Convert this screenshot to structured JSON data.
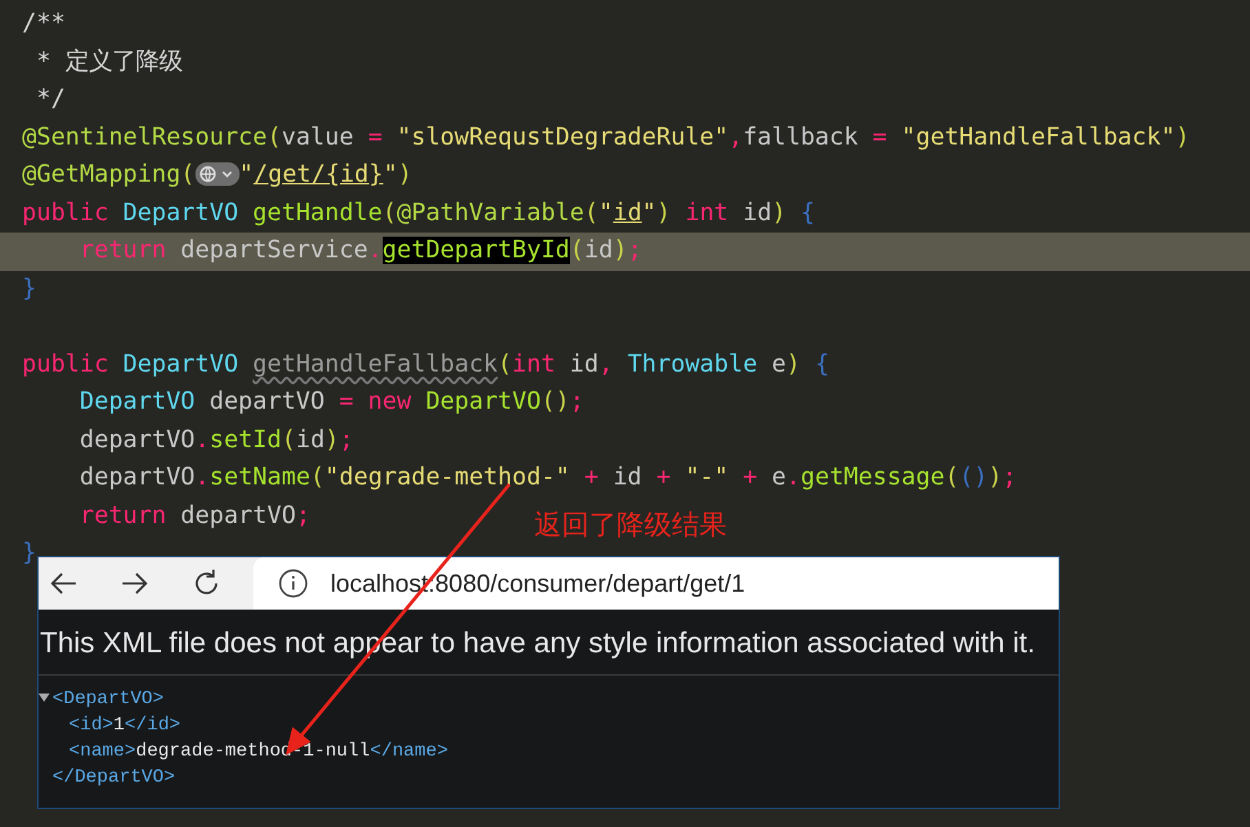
{
  "editor": {
    "methods": [
      {
        "lines": [
          {
            "highlighted": false,
            "tokens": [
              {
                "text": "/**",
                "kind": "comment"
              }
            ]
          },
          {
            "highlighted": false,
            "tokens": [
              {
                "text": " * 定义了降级",
                "kind": "comment"
              }
            ]
          },
          {
            "highlighted": false,
            "tokens": [
              {
                "text": " */",
                "kind": "comment"
              }
            ]
          },
          {
            "highlighted": false,
            "tokens": [
              {
                "text": "@SentinelResource",
                "kind": "annotation"
              },
              {
                "text": "(",
                "kind": "punct"
              },
              {
                "text": "value ",
                "kind": "text"
              },
              {
                "text": "= ",
                "kind": "operator"
              },
              {
                "text": "\"slowRequstDegradeRule\"",
                "kind": "string"
              },
              {
                "text": ",",
                "kind": "operator"
              },
              {
                "text": "fallback ",
                "kind": "text"
              },
              {
                "text": "= ",
                "kind": "operator"
              },
              {
                "text": "\"getHandleFallback\"",
                "kind": "string"
              },
              {
                "text": ")",
                "kind": "punct"
              }
            ]
          },
          {
            "highlighted": false,
            "tokens": [
              {
                "text": "@GetMapping",
                "kind": "annotation"
              },
              {
                "text": "(",
                "kind": "punct"
              },
              {
                "kind": "icon"
              },
              {
                "text": "\"",
                "kind": "string"
              },
              {
                "text": "/get/{id}",
                "kind": "link"
              },
              {
                "text": "\"",
                "kind": "string"
              },
              {
                "text": ")",
                "kind": "punct"
              }
            ]
          },
          {
            "highlighted": false,
            "tokens": [
              {
                "text": "public ",
                "kind": "keyword"
              },
              {
                "text": "DepartVO ",
                "kind": "type"
              },
              {
                "text": "getHandle",
                "kind": "method"
              },
              {
                "text": "(",
                "kind": "punct"
              },
              {
                "text": "@PathVariable",
                "kind": "annotation"
              },
              {
                "text": "(",
                "kind": "punct"
              },
              {
                "text": "\"",
                "kind": "string"
              },
              {
                "text": "id",
                "kind": "link"
              },
              {
                "text": "\"",
                "kind": "string"
              },
              {
                "text": ") ",
                "kind": "punct"
              },
              {
                "text": "int",
                "kind": "keyword"
              },
              {
                "text": " id",
                "kind": "text"
              },
              {
                "text": ") ",
                "kind": "punct"
              },
              {
                "text": "{",
                "kind": "brace"
              }
            ]
          },
          {
            "highlighted": true,
            "tokens": [
              {
                "text": "    return",
                "kind": "keyword"
              },
              {
                "text": " departService",
                "kind": "text"
              },
              {
                "text": ".",
                "kind": "operator"
              },
              {
                "text": "getDepartById",
                "kind": "match"
              },
              {
                "text": "(",
                "kind": "punct"
              },
              {
                "text": "id",
                "kind": "text"
              },
              {
                "text": ")",
                "kind": "punct"
              },
              {
                "text": ";",
                "kind": "operator"
              }
            ]
          },
          {
            "highlighted": false,
            "tokens": [
              {
                "text": "}",
                "kind": "brace"
              }
            ]
          }
        ]
      },
      {
        "lines": [
          {
            "highlighted": false,
            "tokens": [
              {
                "text": "public ",
                "kind": "keyword"
              },
              {
                "text": "DepartVO ",
                "kind": "type"
              },
              {
                "text": "getHandleFallback",
                "kind": "unused"
              },
              {
                "text": "(",
                "kind": "punct"
              },
              {
                "text": "int",
                "kind": "keyword"
              },
              {
                "text": " id",
                "kind": "text"
              },
              {
                "text": ", ",
                "kind": "operator"
              },
              {
                "text": "Throwable",
                "kind": "type"
              },
              {
                "text": " e",
                "kind": "text"
              },
              {
                "text": ") ",
                "kind": "punct"
              },
              {
                "text": "{",
                "kind": "brace"
              }
            ]
          },
          {
            "highlighted": false,
            "tokens": [
              {
                "text": "    DepartVO",
                "kind": "type"
              },
              {
                "text": " departVO ",
                "kind": "text"
              },
              {
                "text": "= ",
                "kind": "operator"
              },
              {
                "text": "new ",
                "kind": "keyword"
              },
              {
                "text": "DepartVO",
                "kind": "method"
              },
              {
                "text": "()",
                "kind": "punct"
              },
              {
                "text": ";",
                "kind": "operator"
              }
            ]
          },
          {
            "highlighted": false,
            "tokens": [
              {
                "text": "    departVO",
                "kind": "text"
              },
              {
                "text": ".",
                "kind": "operator"
              },
              {
                "text": "setId",
                "kind": "method"
              },
              {
                "text": "(",
                "kind": "punct"
              },
              {
                "text": "id",
                "kind": "text"
              },
              {
                "text": ")",
                "kind": "punct"
              },
              {
                "text": ";",
                "kind": "operator"
              }
            ]
          },
          {
            "highlighted": false,
            "tokens": [
              {
                "text": "    departVO",
                "kind": "text"
              },
              {
                "text": ".",
                "kind": "operator"
              },
              {
                "text": "setName",
                "kind": "method"
              },
              {
                "text": "(",
                "kind": "punct"
              },
              {
                "text": "\"degrade-method-\"",
                "kind": "string"
              },
              {
                "text": " +",
                "kind": "operator"
              },
              {
                "text": " id ",
                "kind": "text"
              },
              {
                "text": "+ ",
                "kind": "operator"
              },
              {
                "text": "\"-\"",
                "kind": "string"
              },
              {
                "text": " +",
                "kind": "operator"
              },
              {
                "text": " e",
                "kind": "text"
              },
              {
                "text": ".",
                "kind": "operator"
              },
              {
                "text": "getMessage",
                "kind": "method"
              },
              {
                "text": "(",
                "kind": "punct"
              },
              {
                "text": "()",
                "kind": "brace"
              },
              {
                "text": ")",
                "kind": "punct"
              },
              {
                "text": ";",
                "kind": "operator"
              }
            ]
          },
          {
            "highlighted": false,
            "tokens": [
              {
                "text": "    return",
                "kind": "keyword"
              },
              {
                "text": " departVO",
                "kind": "text"
              },
              {
                "text": ";",
                "kind": "operator"
              }
            ]
          },
          {
            "highlighted": false,
            "tokens": [
              {
                "text": "}",
                "kind": "brace"
              }
            ]
          }
        ]
      }
    ]
  },
  "note": "返回了降级结果",
  "browser": {
    "url": "localhost:8080/consumer/depart/get/1",
    "banner": "This XML file does not appear to have any style information associated with it.",
    "xml": {
      "open": "<DepartVO>",
      "close": "</DepartVO>",
      "expanded": true,
      "children": [
        {
          "open": "<id>",
          "value": "1",
          "close": "</id>"
        },
        {
          "open": "<name>",
          "value": "degrade-method-1-null",
          "close": "</name>"
        }
      ]
    }
  }
}
